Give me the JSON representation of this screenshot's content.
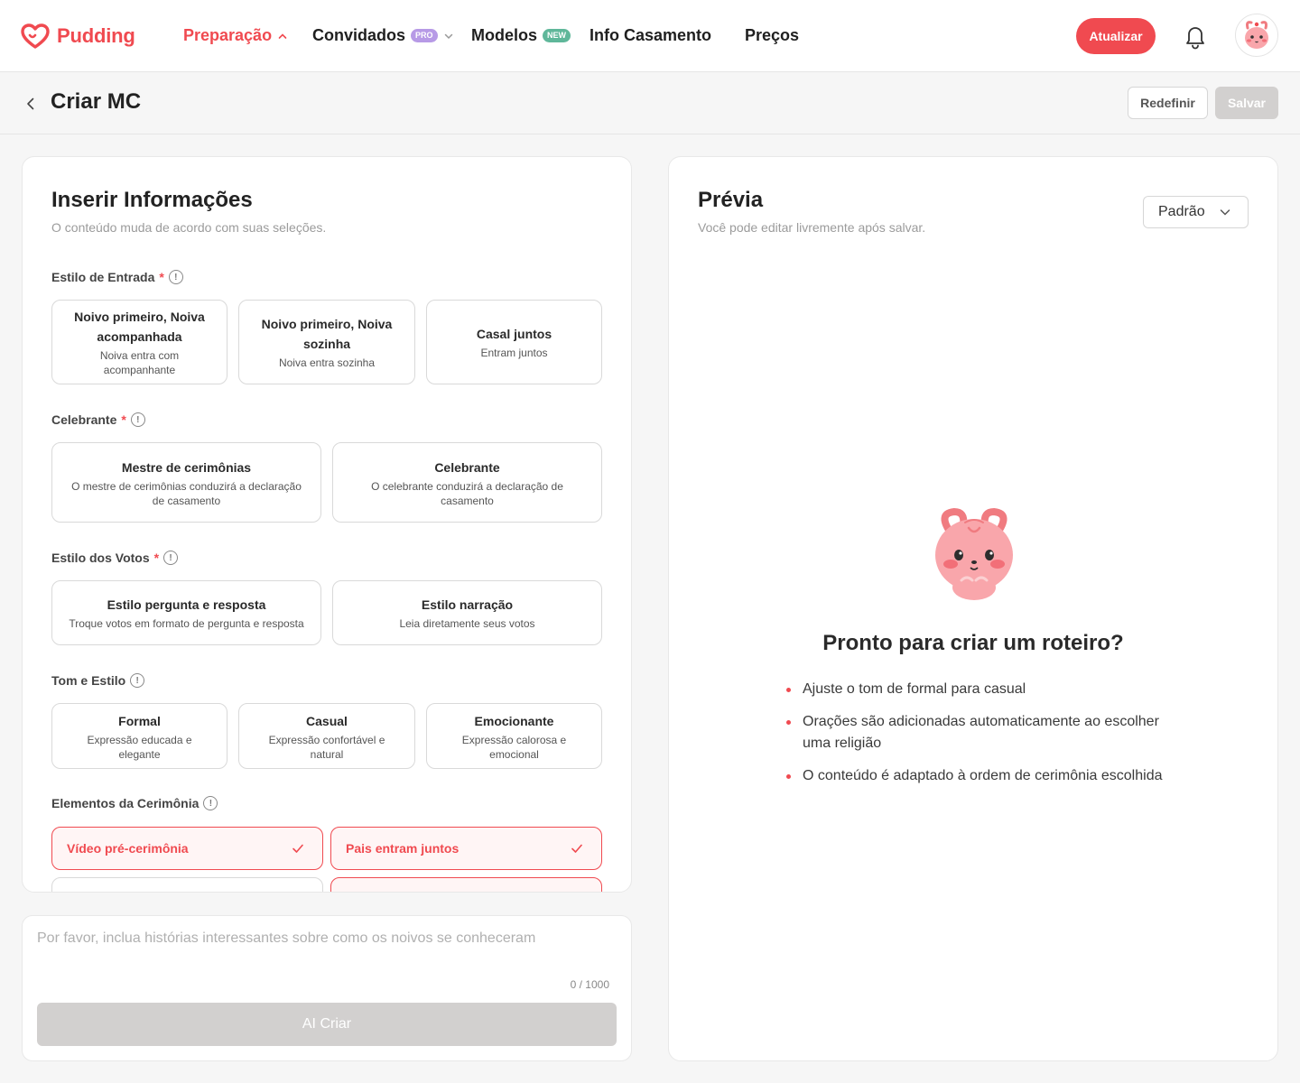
{
  "brand": {
    "name": "Pudding",
    "accent": "#f04a50"
  },
  "nav": {
    "items": [
      {
        "label": "Preparação",
        "active": true,
        "badge": ""
      },
      {
        "label": "Convidados",
        "active": false,
        "badge": "PRO"
      },
      {
        "label": "Modelos",
        "active": false,
        "badge": "NEW"
      },
      {
        "label": "Info Casamento",
        "active": false,
        "badge": ""
      },
      {
        "label": "Preços",
        "active": false,
        "badge": ""
      }
    ],
    "upgrade_label": "Atualizar",
    "icons": [
      "bell-icon",
      "avatar-bunny"
    ]
  },
  "page": {
    "title": "Criar MC",
    "reset_label": "Redefinir",
    "save_label": "Salvar"
  },
  "form": {
    "title": "Inserir Informações",
    "subtitle": "O conteúdo muda de acordo com suas seleções.",
    "entrance": {
      "label": "Estilo de Entrada",
      "options": [
        {
          "title": "Noivo primeiro, Noiva acompanhada",
          "desc": "Noiva entra com acompanhante"
        },
        {
          "title": "Noivo primeiro, Noiva sozinha",
          "desc": "Noiva entra sozinha"
        },
        {
          "title": "Casal juntos",
          "desc": "Entram juntos"
        }
      ]
    },
    "officiant": {
      "label": "Celebrante",
      "options": [
        {
          "title": "Mestre de cerimônias",
          "desc": "O mestre de cerimônias conduzirá a declaração de casamento"
        },
        {
          "title": "Celebrante",
          "desc": "O celebrante conduzirá a declaração de casamento"
        }
      ]
    },
    "vows": {
      "label": "Estilo dos Votos",
      "options": [
        {
          "title": "Estilo pergunta e resposta",
          "desc": "Troque votos em formato de pergunta e resposta"
        },
        {
          "title": "Estilo narração",
          "desc": "Leia diretamente seus votos"
        }
      ]
    },
    "tone": {
      "label": "Tom e Estilo",
      "options": [
        {
          "title": "Formal",
          "desc": "Expressão educada e elegante"
        },
        {
          "title": "Casual",
          "desc": "Expressão confortável e natural"
        },
        {
          "title": "Emocionante",
          "desc": "Expressão calorosa e emocional"
        }
      ]
    },
    "elements": {
      "label": "Elementos da Cerimônia",
      "options": [
        {
          "title": "Vídeo pré-cerimônia",
          "checked": true
        },
        {
          "title": "Pais entram juntos",
          "checked": true
        }
      ]
    }
  },
  "prompt": {
    "placeholder": "Por favor, inclua histórias interessantes sobre como os noivos se conheceram",
    "counter": "0 / 1000",
    "button_label": "AI Criar"
  },
  "preview": {
    "title": "Prévia",
    "subtitle": "Você pode editar livremente após salvar.",
    "select_value": "Padrão",
    "empty_title": "Pronto para criar um roteiro?",
    "tips": [
      "Ajuste o tom de formal para casual",
      "Orações são adicionadas automaticamente ao escolher uma religião",
      "O conteúdo é adaptado à ordem de cerimônia escolhida"
    ]
  }
}
